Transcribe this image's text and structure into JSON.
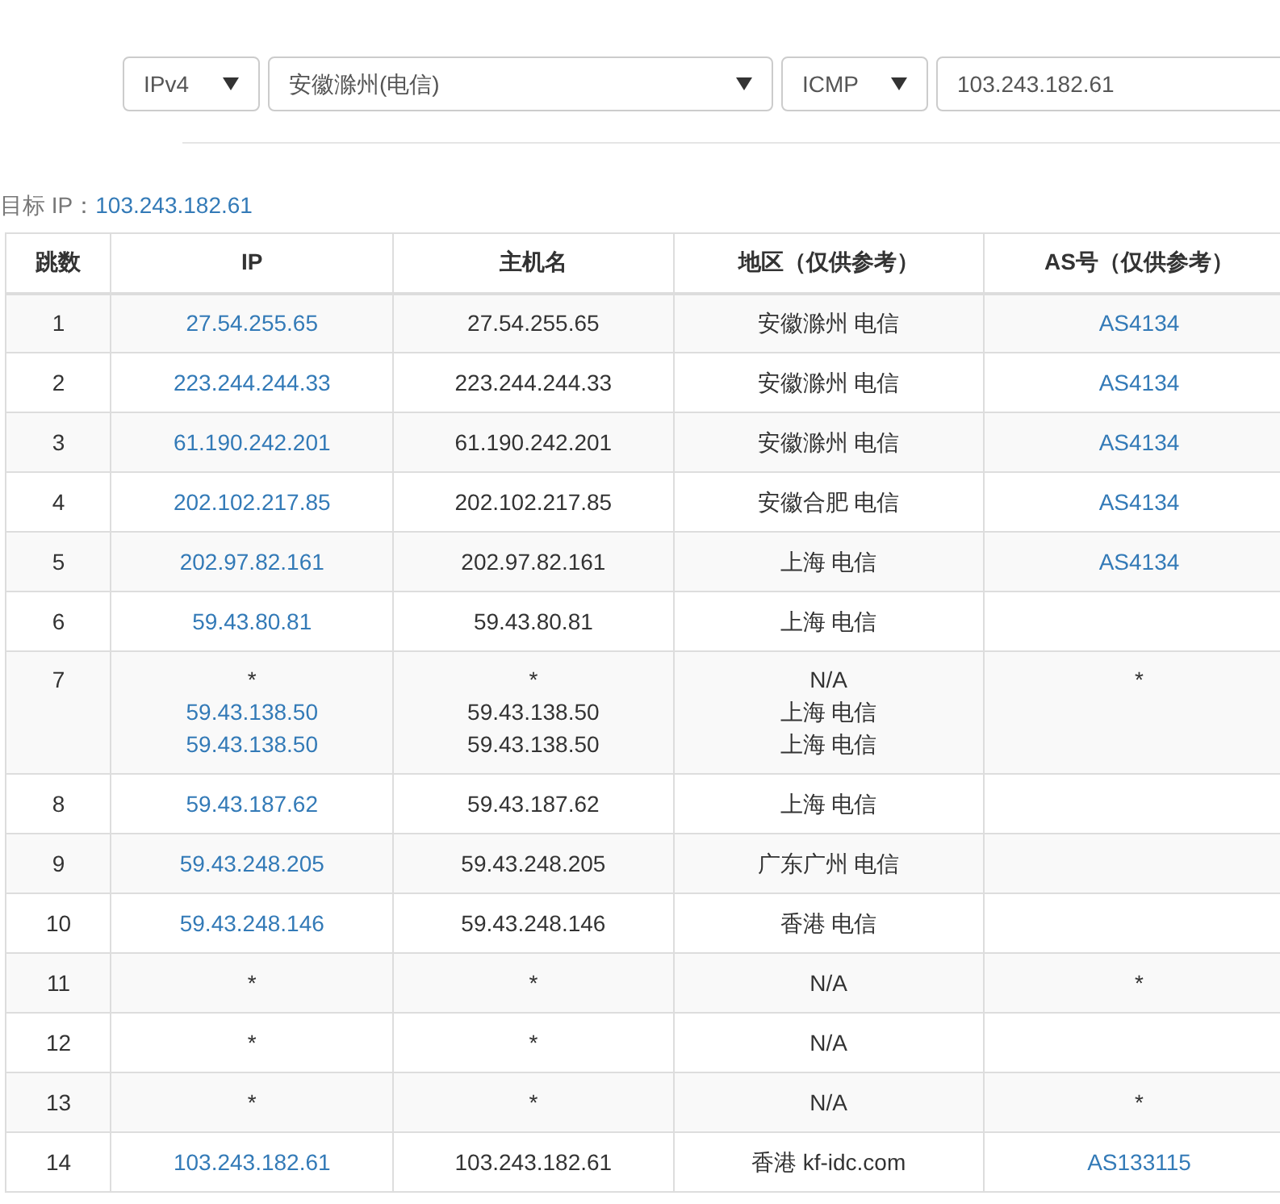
{
  "form": {
    "ip_version": "IPv4",
    "node": "安徽滁州(电信)",
    "protocol": "ICMP",
    "target": "103.243.182.61"
  },
  "target_label": "目标 IP：",
  "target_value": "103.243.182.61",
  "table": {
    "columns": [
      "跳数",
      "IP",
      "主机名",
      "地区（仅供参考）",
      "AS号（仅供参考）"
    ],
    "rows": [
      {
        "hop": "1",
        "ip": [
          {
            "text": "27.54.255.65",
            "link": true
          }
        ],
        "host": [
          "27.54.255.65"
        ],
        "region": [
          "安徽滁州 电信"
        ],
        "asn": [
          {
            "text": "AS4134",
            "link": true
          }
        ]
      },
      {
        "hop": "2",
        "ip": [
          {
            "text": "223.244.244.33",
            "link": true
          }
        ],
        "host": [
          "223.244.244.33"
        ],
        "region": [
          "安徽滁州 电信"
        ],
        "asn": [
          {
            "text": "AS4134",
            "link": true
          }
        ]
      },
      {
        "hop": "3",
        "ip": [
          {
            "text": "61.190.242.201",
            "link": true
          }
        ],
        "host": [
          "61.190.242.201"
        ],
        "region": [
          "安徽滁州 电信"
        ],
        "asn": [
          {
            "text": "AS4134",
            "link": true
          }
        ]
      },
      {
        "hop": "4",
        "ip": [
          {
            "text": "202.102.217.85",
            "link": true
          }
        ],
        "host": [
          "202.102.217.85"
        ],
        "region": [
          "安徽合肥 电信"
        ],
        "asn": [
          {
            "text": "AS4134",
            "link": true
          }
        ]
      },
      {
        "hop": "5",
        "ip": [
          {
            "text": "202.97.82.161",
            "link": true
          }
        ],
        "host": [
          "202.97.82.161"
        ],
        "region": [
          "上海 电信"
        ],
        "asn": [
          {
            "text": "AS4134",
            "link": true
          }
        ]
      },
      {
        "hop": "6",
        "ip": [
          {
            "text": "59.43.80.81",
            "link": true
          }
        ],
        "host": [
          "59.43.80.81"
        ],
        "region": [
          "上海 电信"
        ],
        "asn": []
      },
      {
        "hop": "7",
        "ip": [
          {
            "text": "*",
            "link": false
          },
          {
            "text": "59.43.138.50",
            "link": true
          },
          {
            "text": "59.43.138.50",
            "link": true
          }
        ],
        "host": [
          "*",
          "59.43.138.50",
          "59.43.138.50"
        ],
        "region": [
          "N/A",
          "上海 电信",
          "上海 电信"
        ],
        "asn": [
          {
            "text": "*",
            "link": false
          }
        ]
      },
      {
        "hop": "8",
        "ip": [
          {
            "text": "59.43.187.62",
            "link": true
          }
        ],
        "host": [
          "59.43.187.62"
        ],
        "region": [
          "上海 电信"
        ],
        "asn": []
      },
      {
        "hop": "9",
        "ip": [
          {
            "text": "59.43.248.205",
            "link": true
          }
        ],
        "host": [
          "59.43.248.205"
        ],
        "region": [
          "广东广州 电信"
        ],
        "asn": []
      },
      {
        "hop": "10",
        "ip": [
          {
            "text": "59.43.248.146",
            "link": true
          }
        ],
        "host": [
          "59.43.248.146"
        ],
        "region": [
          "香港 电信"
        ],
        "asn": []
      },
      {
        "hop": "11",
        "ip": [
          {
            "text": "*",
            "link": false
          }
        ],
        "host": [
          "*"
        ],
        "region": [
          "N/A"
        ],
        "asn": [
          {
            "text": "*",
            "link": false
          }
        ]
      },
      {
        "hop": "12",
        "ip": [
          {
            "text": "*",
            "link": false
          }
        ],
        "host": [
          "*"
        ],
        "region": [
          "N/A"
        ],
        "asn": []
      },
      {
        "hop": "13",
        "ip": [
          {
            "text": "*",
            "link": false
          }
        ],
        "host": [
          "*"
        ],
        "region": [
          "N/A"
        ],
        "asn": [
          {
            "text": "*",
            "link": false
          }
        ]
      },
      {
        "hop": "14",
        "ip": [
          {
            "text": "103.243.182.61",
            "link": true
          }
        ],
        "host": [
          "103.243.182.61"
        ],
        "region": [
          "香港 kf-idc.com"
        ],
        "asn": [
          {
            "text": "AS133115",
            "link": true
          }
        ]
      }
    ]
  }
}
